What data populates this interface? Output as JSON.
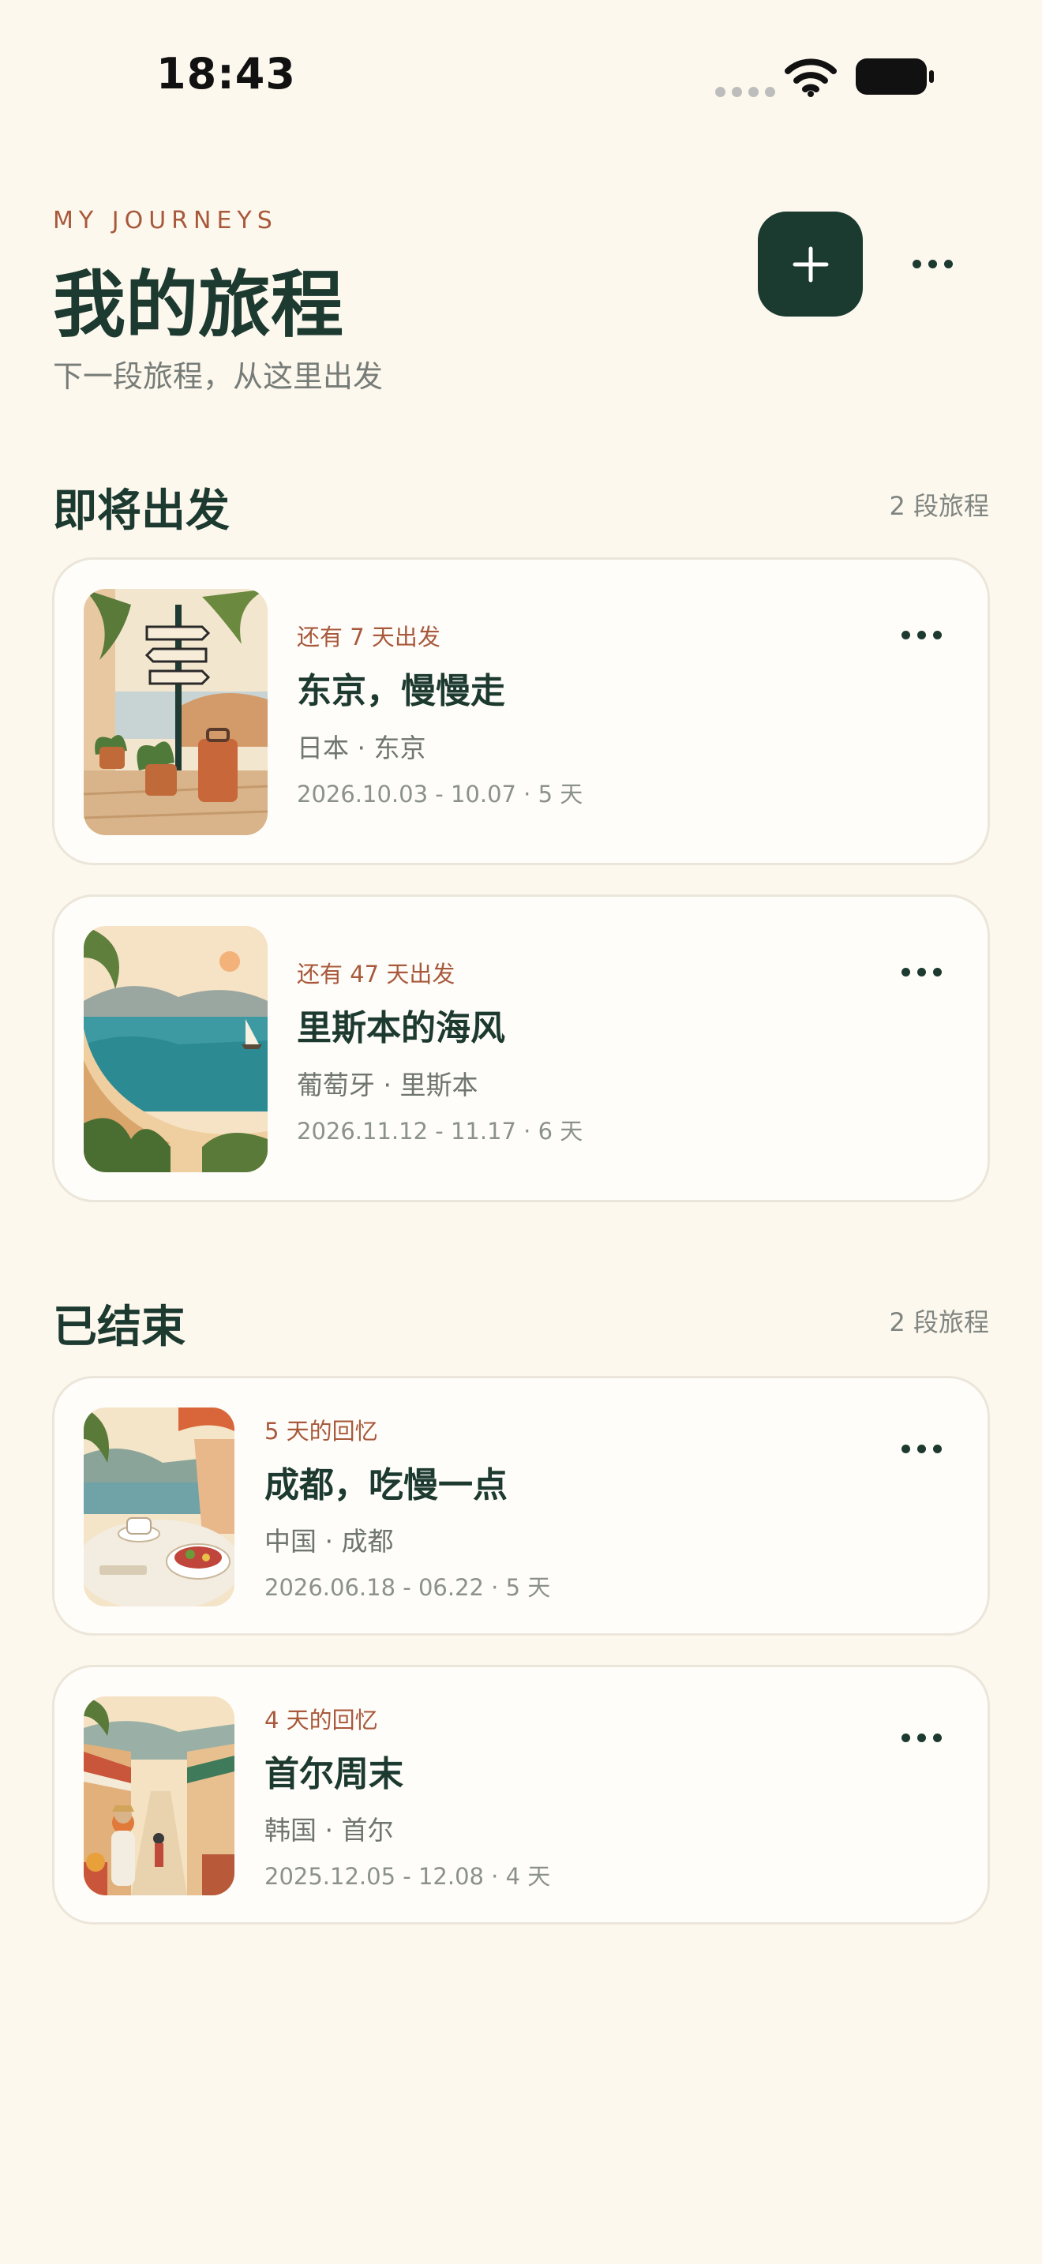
{
  "status_bar": {
    "time": "18:43"
  },
  "header": {
    "eyebrow": "MY JOURNEYS",
    "title": "我的旅程",
    "subtitle": "下一段旅程，从这里出发"
  },
  "upcoming": {
    "title": "即将出发",
    "count": "2 段旅程",
    "trips": [
      {
        "meta": "还有 7 天出发",
        "title": "东京，慢慢走",
        "place": "日本 · 东京",
        "dates": "2026.10.03 - 10.07 · 5 天"
      },
      {
        "meta": "还有 47 天出发",
        "title": "里斯本的海风",
        "place": "葡萄牙 · 里斯本",
        "dates": "2026.11.12 - 11.17 · 6 天"
      }
    ]
  },
  "finished": {
    "title": "已结束",
    "count": "2 段旅程",
    "trips": [
      {
        "meta": "5 天的回忆",
        "title": "成都，吃慢一点",
        "place": "中国 · 成都",
        "dates": "2026.06.18 - 06.22 · 5 天"
      },
      {
        "meta": "4 天的回忆",
        "title": "首尔周末",
        "place": "韩国 · 首尔",
        "dates": "2025.12.05 - 12.08 · 4 天"
      }
    ]
  },
  "colors": {
    "background": "#fdf8ee",
    "primary": "#1b3a30",
    "accent": "#a8593c"
  },
  "icons": [
    "wifi-icon",
    "battery-icon",
    "plus-icon",
    "more-icon"
  ]
}
